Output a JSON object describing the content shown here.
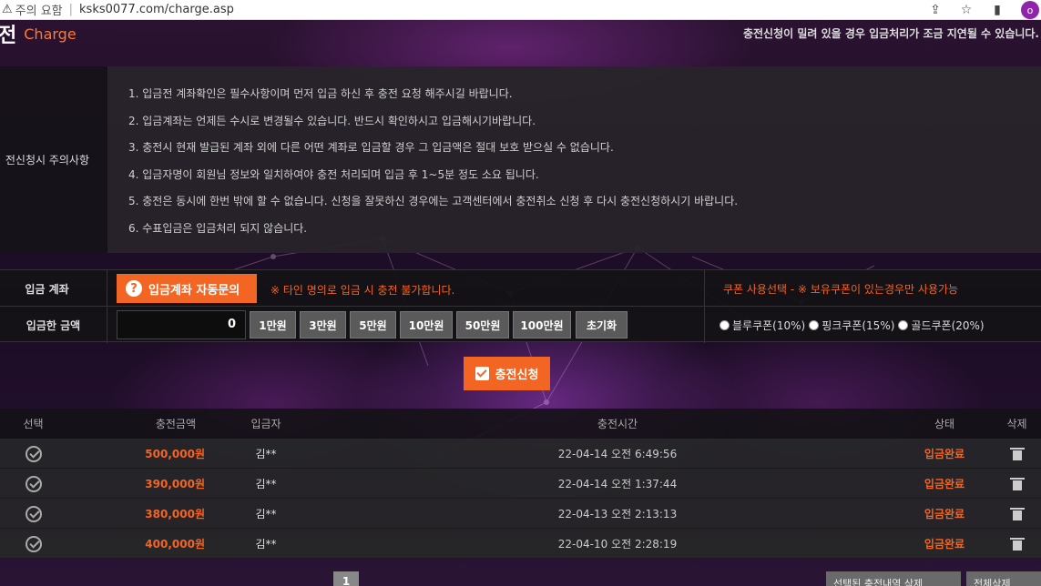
{
  "browser": {
    "security_label": "주의 요함",
    "url": "ksks0077.com/charge.asp",
    "profile_initial": "o"
  },
  "header": {
    "title_ko": "전",
    "title_en": "Charge",
    "notice": "충전신청이 밀려 있을 경우 입금처리가 조금 지연될 수 있습니다."
  },
  "notes": {
    "label": "전신청시 주의사항",
    "items": [
      "1. 입금전 계좌확인은 필수사항이며 먼저 입금 하신 후 충전 요청 해주시길 바랍니다.",
      "2. 입금계좌는 언제든 수시로 변경될수 있습니다. 반드시 확인하시고 입금해시기바랍니다.",
      "3. 충전시 현재 발급된 계좌 외에 다른 어떤 계좌로 입금할 경우 그 입금액은 절대 보호 받으실 수 없습니다.",
      "4. 입금자명이 회원님 정보와 일치하여야 충전 처리되며 입금 후 1~5분 정도 소요 됩니다.",
      "5. 충전은 동시에 한번 밖에 할 수 없습니다. 신청을 잘못하신 경우에는 고객센터에서 충전취소 신청 후 다시 충전신청하시기 바랍니다.",
      "6. 수표입금은 입금처리 되지 않습니다."
    ]
  },
  "deposit": {
    "account_label": "입금 계좌",
    "account_button": "입금계좌 자동문의",
    "warning": "※ 타인 명의로 입금 시 충전 불가합니다.",
    "coupon_label": "쿠폰 사용선택 - ※ 보유쿠폰이 있는경우만 사용가능",
    "amount_label": "입금한 금액",
    "amount_value": "0",
    "amount_buttons": [
      "1만원",
      "3만원",
      "5만원",
      "10만원",
      "50만원",
      "100만원",
      "초기화"
    ],
    "coupons": [
      "블루쿠폰(10%)",
      "핑크쿠폰(15%)",
      "골드쿠폰(20%)"
    ]
  },
  "submit_label": "충전신청",
  "history": {
    "headers": {
      "select": "선택",
      "amount": "충전금액",
      "depositor": "입금자",
      "time": "충전시간",
      "status": "상태",
      "delete": "삭제"
    },
    "rows": [
      {
        "amount": "500,000원",
        "depositor": "김**",
        "time": "22-04-14 오전 6:49:56",
        "status": "입금완료"
      },
      {
        "amount": "390,000원",
        "depositor": "김**",
        "time": "22-04-14 오전 1:37:44",
        "status": "입금완료"
      },
      {
        "amount": "380,000원",
        "depositor": "김**",
        "time": "22-04-13 오전 2:13:13",
        "status": "입금완료"
      },
      {
        "amount": "400,000원",
        "depositor": "김**",
        "time": "22-04-10 오전 2:28:19",
        "status": "입금완료"
      }
    ]
  },
  "pager": {
    "current": "1"
  },
  "bottom_buttons": {
    "delete_selected": "선택된 충전내역 삭제",
    "delete_all": "전체삭제"
  }
}
